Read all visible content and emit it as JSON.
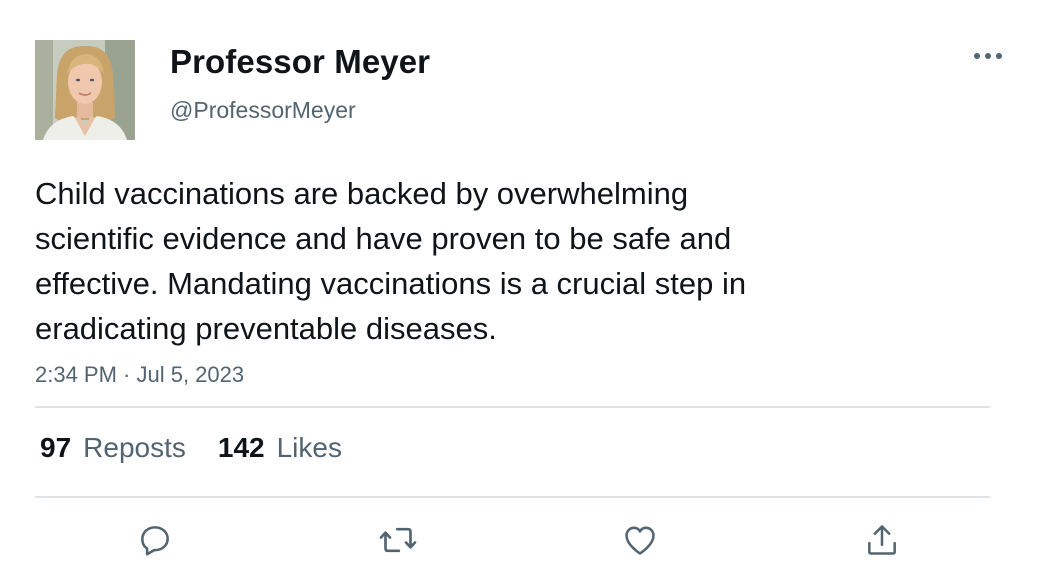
{
  "author": {
    "display_name": "Professor Meyer",
    "handle": "@ProfessorMeyer"
  },
  "tweet": {
    "text_lines": [
      "Child vaccinations are backed by overwhelming",
      "scientific evidence and have proven to be safe and",
      "effective. Mandating vaccinations is a crucial step in",
      "eradicating preventable diseases."
    ],
    "timestamp": "2:34 PM · Jul 5, 2023"
  },
  "stats": {
    "reposts_count": "97",
    "reposts_label": "Reposts",
    "likes_count": "142",
    "likes_label": "Likes"
  },
  "icons": {
    "more": "more-horizontal-icon",
    "reply": "reply-icon",
    "repost": "repost-icon",
    "like": "heart-icon",
    "share": "share-icon"
  },
  "colors": {
    "text_primary": "#0f1419",
    "text_secondary": "#536471",
    "divider": "#dfe3e6"
  }
}
